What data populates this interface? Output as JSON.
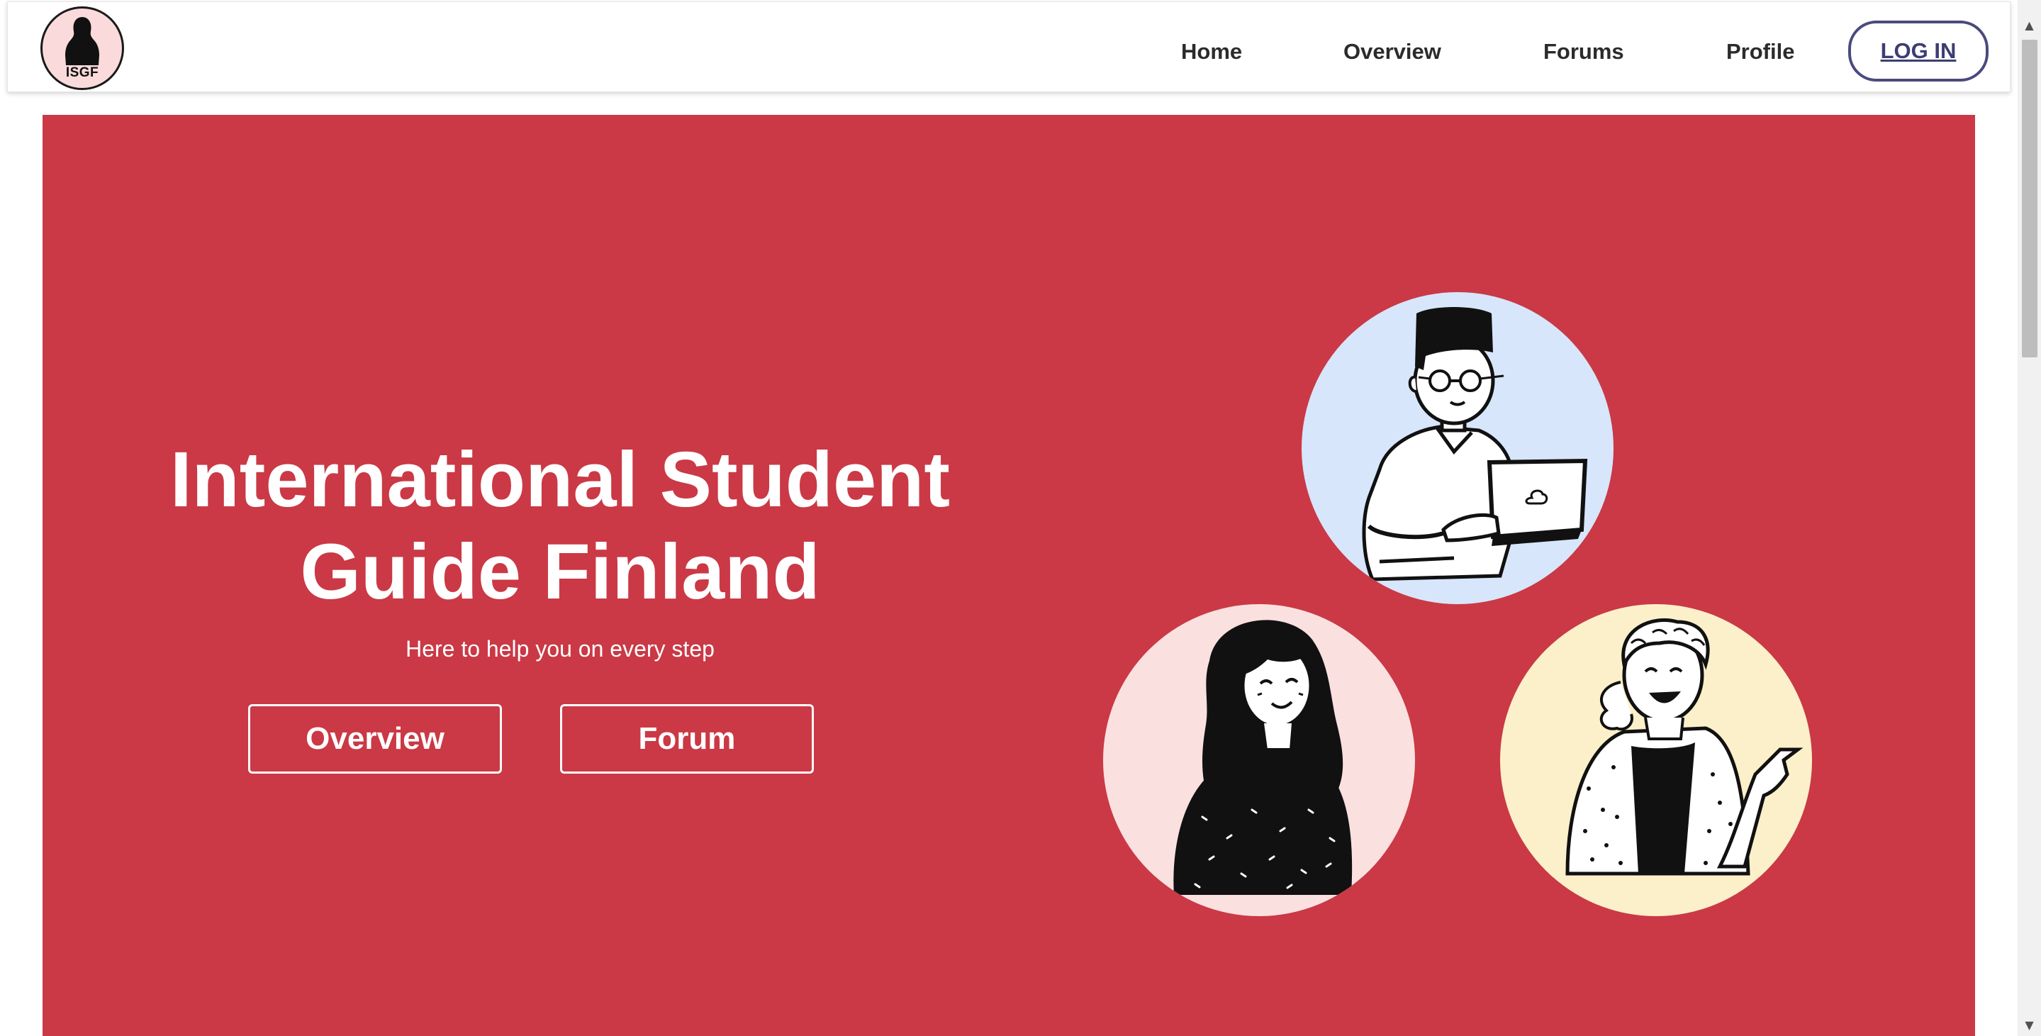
{
  "brand": {
    "logo_text": "ISGF",
    "logo_bg": "#fadada"
  },
  "nav": {
    "items": [
      {
        "label": "Home"
      },
      {
        "label": "Overview"
      },
      {
        "label": "Forums"
      },
      {
        "label": "Profile"
      }
    ],
    "login_label": "LOG IN"
  },
  "hero": {
    "title_line1": "International Student",
    "title_line2": "Guide Finland",
    "subtitle": "Here to help you on every step",
    "overview_button": "Overview",
    "forum_button": "Forum",
    "background_color": "#ca3945"
  },
  "illustrations": [
    {
      "icon": "student-with-laptop-illustration",
      "bg": "#d7e6fb"
    },
    {
      "icon": "smiling-woman-illustration",
      "bg": "#fbe0e0"
    },
    {
      "icon": "pointing-woman-illustration",
      "bg": "#fbf0c9"
    }
  ],
  "colors": {
    "accent": "#ca3945",
    "login_border": "#4a4a7e"
  }
}
